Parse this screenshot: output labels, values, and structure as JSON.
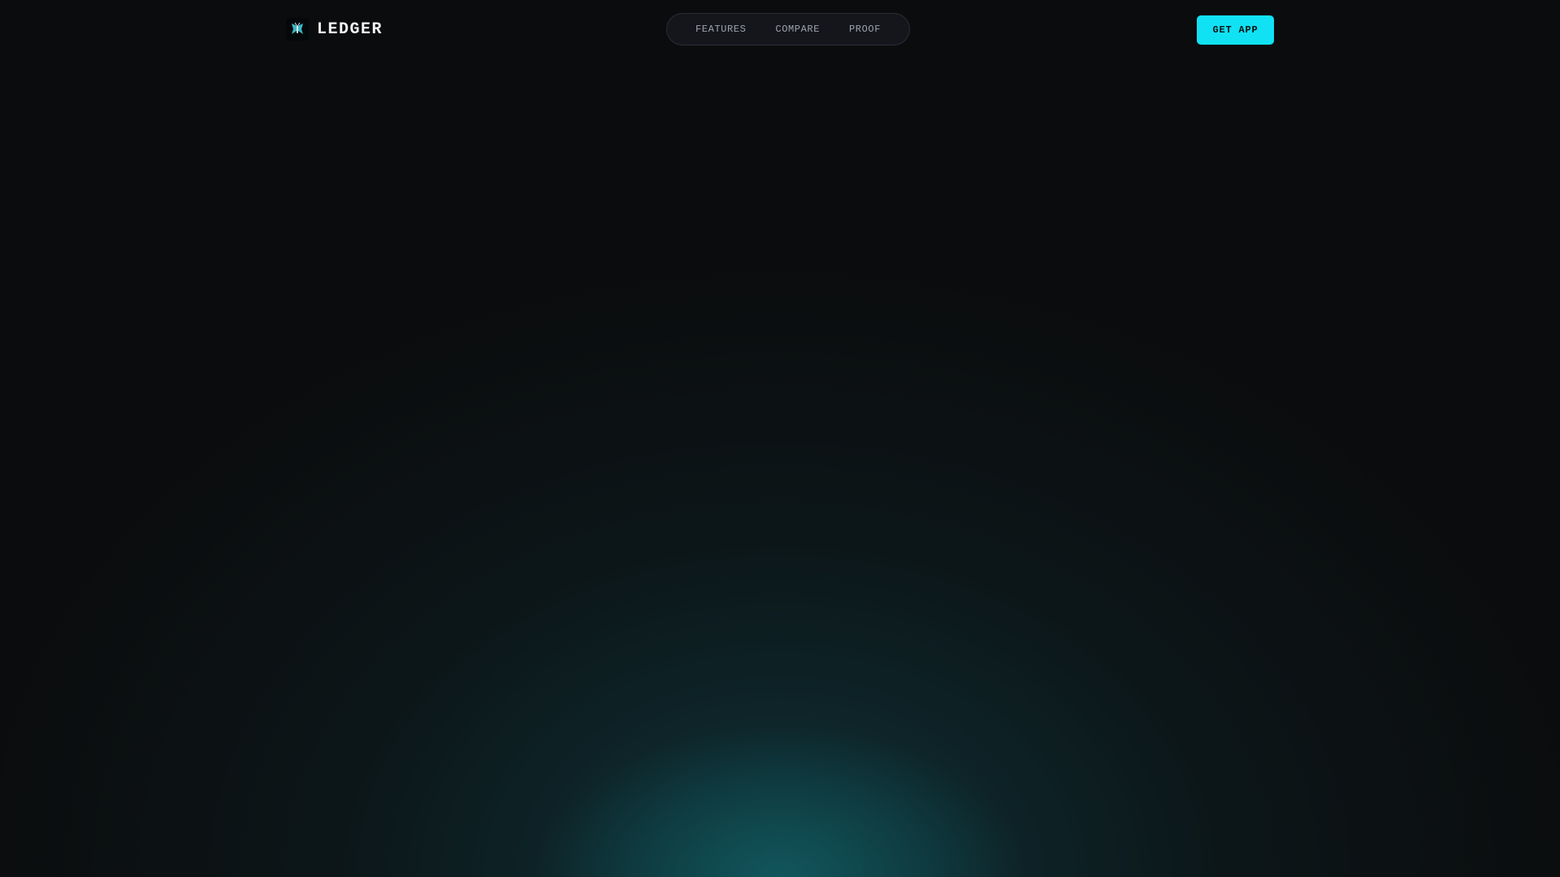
{
  "brand": {
    "name": "LEDGER",
    "logo_icon": "moth-logo-icon"
  },
  "nav": {
    "items": [
      {
        "label": "FEATURES"
      },
      {
        "label": "COMPARE"
      },
      {
        "label": "PROOF"
      }
    ]
  },
  "cta": {
    "label": "GET APP"
  },
  "colors": {
    "background": "#0b0c0d",
    "accent": "#10e2f4",
    "glow": "#105c62"
  }
}
